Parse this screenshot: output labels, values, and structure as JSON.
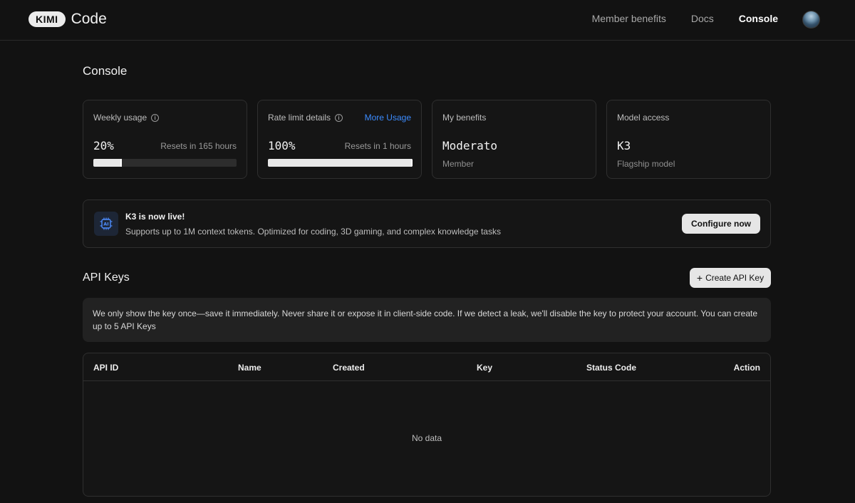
{
  "header": {
    "logo_mark": "KIMI",
    "logo_text": "Code",
    "nav": [
      {
        "label": "Member benefits"
      },
      {
        "label": "Docs"
      },
      {
        "label": "Console"
      }
    ]
  },
  "page": {
    "title": "Console"
  },
  "cards": {
    "weekly": {
      "label": "Weekly usage",
      "value": "20%",
      "reset": "Resets in 165 hours",
      "progress": 0.2
    },
    "rate": {
      "label": "Rate limit details",
      "link": "More Usage",
      "value": "100%",
      "reset": "Resets in 1 hours",
      "progress": 1.0
    },
    "benefits": {
      "label": "My benefits",
      "value": "Moderato",
      "sub": "Member"
    },
    "model": {
      "label": "Model access",
      "value": "K3",
      "sub": "Flagship model"
    }
  },
  "banner": {
    "icon_text": "AI",
    "title": "K3 is now live!",
    "desc": "Supports up to 1M context tokens. Optimized for coding, 3D gaming, and complex knowledge tasks",
    "button": "Configure now"
  },
  "api_keys": {
    "title": "API Keys",
    "create_button": "Create API Key",
    "notice": "We only show the key once—save it immediately. Never share it or expose it in client-side code. If we detect a leak, we'll disable the key to protect your account. You can create up to 5 API Keys",
    "columns": [
      "API ID",
      "Name",
      "Created",
      "Key",
      "Status Code",
      "Action"
    ],
    "empty": "No data"
  },
  "colors": {
    "accent_link": "#3c8cff",
    "background": "#121212"
  }
}
